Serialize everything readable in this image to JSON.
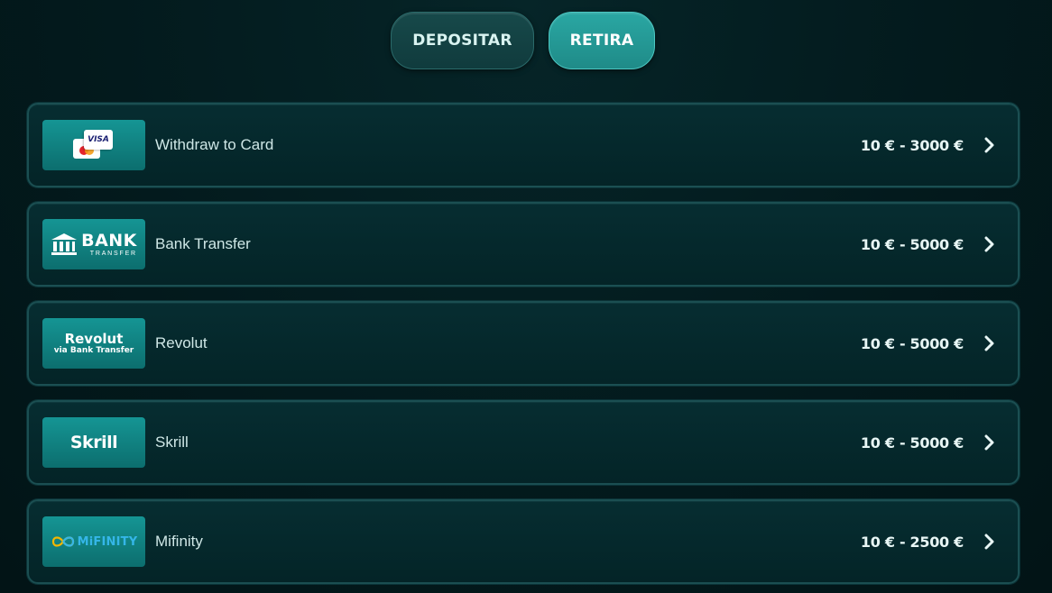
{
  "tabs": {
    "deposit_label": "DEPOSITAR",
    "withdraw_label": "RETIRA",
    "active": "withdraw"
  },
  "methods": [
    {
      "name": "Withdraw to Card",
      "limits": "10 € - 3000 €",
      "logo": {
        "icon": "card-icon",
        "text": "VISA"
      }
    },
    {
      "name": "Bank Transfer",
      "limits": "10 € - 5000 €",
      "logo": {
        "icon": "bank-icon",
        "text": "BANK",
        "subtext": "TRANSFER"
      }
    },
    {
      "name": "Revolut",
      "limits": "10 € - 5000 €",
      "logo": {
        "text": "Revolut",
        "subtext": "via Bank Transfer"
      }
    },
    {
      "name": "Skrill",
      "limits": "10 € - 5000 €",
      "logo": {
        "text": "Skrill"
      }
    },
    {
      "name": "Mifinity",
      "limits": "10 € - 2500 €",
      "logo": {
        "icon": "infinity-icon",
        "text": "MiFINITY"
      }
    }
  ],
  "colors": {
    "background": "#03191c",
    "active_tab": "#24a09c",
    "logo_tile": "#118281",
    "mifinity_blue": "#35b6e8"
  }
}
